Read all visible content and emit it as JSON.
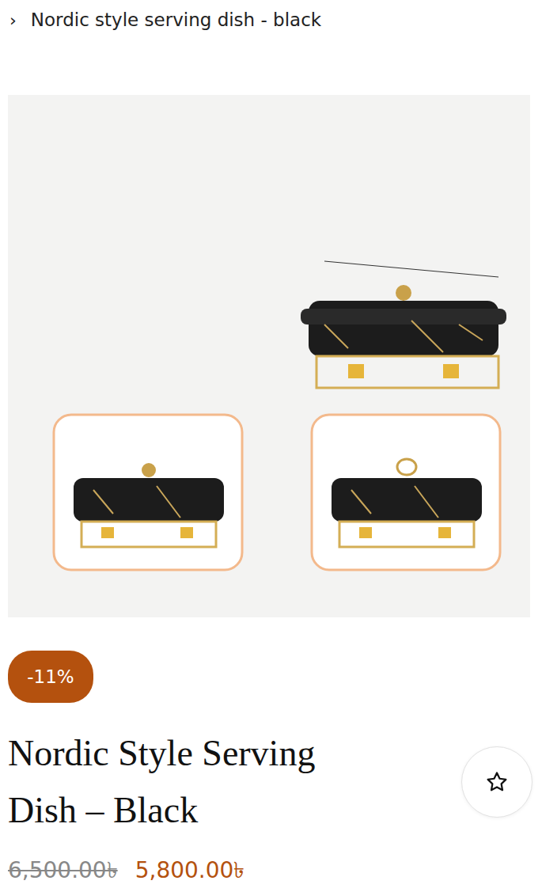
{
  "breadcrumb": {
    "separator": "›",
    "label": "Nordic style serving dish - black"
  },
  "product": {
    "discount_badge": "-11%",
    "title": "Nordic Style Serving Dish – Black",
    "price": {
      "original": "6,500.00৳",
      "sale": "5,800.00৳"
    },
    "wishlist": {
      "selected": false
    }
  }
}
